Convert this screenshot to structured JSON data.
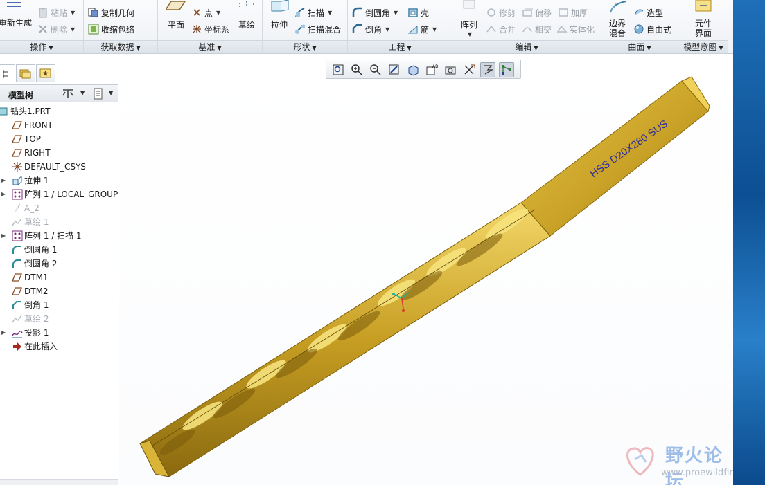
{
  "ribbon": {
    "operations": {
      "label": "操作",
      "regenerate": "重新生成",
      "paste": "粘贴",
      "delete": "删除"
    },
    "get_data": {
      "label": "获取数据",
      "copy_geometry": "复制几何",
      "shrinkwrap": "收缩包络"
    },
    "datum": {
      "label": "基准",
      "plane": "平面",
      "point": "点",
      "csys": "坐标系",
      "sketch": "草绘"
    },
    "shapes": {
      "label": "形状",
      "extrude": "拉伸",
      "sweep": "扫描",
      "swept_blend": "扫描混合"
    },
    "engineering": {
      "label": "工程",
      "round": "倒圆角",
      "chamfer": "倒角",
      "shell": "壳",
      "rib": "筋"
    },
    "editing": {
      "label": "编辑",
      "pattern": "阵列",
      "trim": "修剪",
      "offset": "偏移",
      "thicken": "加厚",
      "merge": "合并",
      "intersect": "相交",
      "solidify": "实体化"
    },
    "surfaces": {
      "label": "曲面",
      "boundary_blend_1": "边界",
      "boundary_blend_2": "混合",
      "style": "造型",
      "freestyle": "自由式"
    },
    "model_intent": {
      "label": "模型意图",
      "component_interface_1": "元件",
      "component_interface_2": "界面"
    }
  },
  "panel": {
    "title": "模型树",
    "tree": [
      {
        "label": "钻头1.PRT",
        "icon": "part-icon",
        "root": true
      },
      {
        "label": "FRONT",
        "icon": "datum-plane-icon"
      },
      {
        "label": "TOP",
        "icon": "datum-plane-icon"
      },
      {
        "label": "RIGHT",
        "icon": "datum-plane-icon"
      },
      {
        "label": "DEFAULT_CSYS",
        "icon": "csys-icon"
      },
      {
        "label": "拉伸 1",
        "icon": "extrude-icon",
        "expandable": true
      },
      {
        "label": "阵列 1 / LOCAL_GROUP",
        "icon": "pattern-icon",
        "expandable": true
      },
      {
        "label": "A_2",
        "icon": "datum-axis-icon",
        "dim": true
      },
      {
        "label": "草绘 1",
        "icon": "sketch-icon",
        "dim": true
      },
      {
        "label": "阵列 1 / 扫描 1",
        "icon": "pattern-icon",
        "expandable": true
      },
      {
        "label": "倒圆角 1",
        "icon": "round-icon"
      },
      {
        "label": "倒圆角 2",
        "icon": "round-icon"
      },
      {
        "label": "DTM1",
        "icon": "datum-plane-icon"
      },
      {
        "label": "DTM2",
        "icon": "datum-plane-icon"
      },
      {
        "label": "倒角 1",
        "icon": "chamfer-icon"
      },
      {
        "label": "草绘 2",
        "icon": "sketch-icon",
        "dim": true
      },
      {
        "label": "投影 1",
        "icon": "projection-icon",
        "expandable": true
      },
      {
        "label": "在此插入",
        "icon": "insert-here-arrow-icon"
      }
    ]
  },
  "model": {
    "engraving": "HSS  D20X280  SUS",
    "body_color": "#c9a227"
  },
  "watermark": {
    "brand": "野火论坛",
    "url": "www.proewildfire.cn"
  }
}
